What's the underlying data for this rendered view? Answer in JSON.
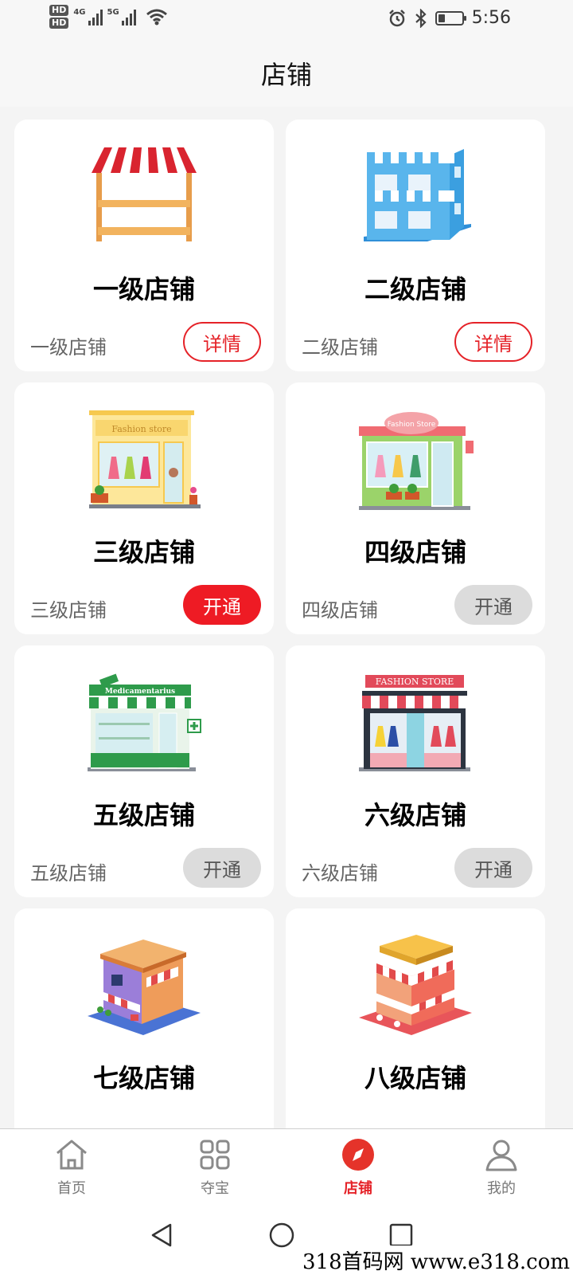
{
  "status_bar": {
    "left": {
      "hd1": "HD",
      "hd2": "HD",
      "net1": "4G",
      "net2": "5G"
    },
    "time": "5:56"
  },
  "header": {
    "title": "店铺"
  },
  "shops": [
    {
      "title": "一级店铺",
      "subtitle": "一级店铺",
      "button": "详情",
      "button_style": "outline",
      "icon": "market-stall-icon"
    },
    {
      "title": "二级店铺",
      "subtitle": "二级店铺",
      "button": "详情",
      "button_style": "outline",
      "icon": "two-story-shop-icon"
    },
    {
      "title": "三级店铺",
      "subtitle": "三级店铺",
      "button": "开通",
      "button_style": "solid",
      "icon": "fashion-store-yellow-icon"
    },
    {
      "title": "四级店铺",
      "subtitle": "四级店铺",
      "button": "开通",
      "button_style": "disabled",
      "icon": "fashion-store-green-icon"
    },
    {
      "title": "五级店铺",
      "subtitle": "五级店铺",
      "button": "开通",
      "button_style": "disabled",
      "icon": "pharmacy-store-icon"
    },
    {
      "title": "六级店铺",
      "subtitle": "六级店铺",
      "button": "开通",
      "button_style": "disabled",
      "icon": "fashion-store-dark-icon"
    },
    {
      "title": "七级店铺",
      "icon": "isometric-cafe-icon"
    },
    {
      "title": "八级店铺",
      "icon": "isometric-restaurant-icon"
    }
  ],
  "shop_signs": {
    "yellow": "Fashion store",
    "green": "Fashion Store",
    "pharmacy": "Medicamentarius",
    "dark": "FASHION STORE"
  },
  "tabs": [
    {
      "label": "首页",
      "icon": "home-icon",
      "active": false
    },
    {
      "label": "夺宝",
      "icon": "grid-icon",
      "active": false
    },
    {
      "label": "店铺",
      "icon": "compass-icon",
      "active": true
    },
    {
      "label": "我的",
      "icon": "user-icon",
      "active": false
    }
  ],
  "watermark": "318首码网 www.e318.com",
  "colors": {
    "accent": "#e52228",
    "background": "#f4f4f4",
    "card": "#ffffff",
    "disabled": "#dcdcdc"
  }
}
